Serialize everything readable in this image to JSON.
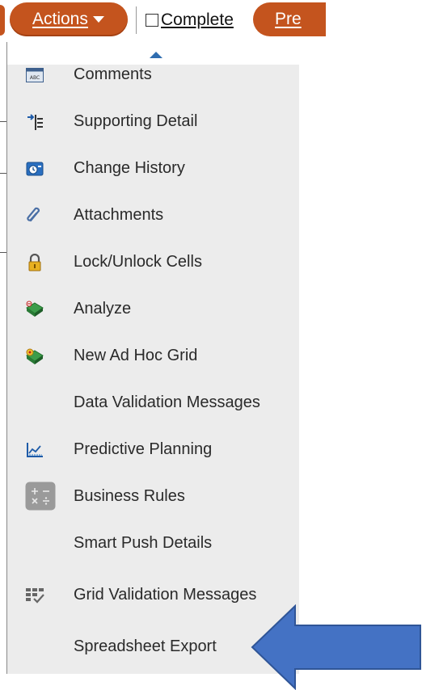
{
  "toolbar": {
    "actions_label": "Actions",
    "complete_label": "Complete",
    "complete_checked": false,
    "prev_label": "Pre"
  },
  "menu": {
    "items": [
      {
        "label": "Comments",
        "icon": "comments-icon"
      },
      {
        "label": "Supporting Detail",
        "icon": "supporting-detail-icon"
      },
      {
        "label": "Change History",
        "icon": "change-history-icon"
      },
      {
        "label": "Attachments",
        "icon": "paperclip-icon"
      },
      {
        "label": "Lock/Unlock Cells",
        "icon": "lock-icon"
      },
      {
        "label": "Analyze",
        "icon": "analyze-icon"
      },
      {
        "label": "New Ad Hoc Grid",
        "icon": "new-ad-hoc-grid-icon"
      },
      {
        "label": "Data Validation Messages",
        "icon": ""
      },
      {
        "label": "Predictive Planning",
        "icon": "predictive-planning-icon"
      },
      {
        "label": "Business Rules",
        "icon": "calculator-icon"
      },
      {
        "label": "Smart Push Details",
        "icon": ""
      },
      {
        "label": "Grid Validation Messages",
        "icon": "grid-validation-icon"
      },
      {
        "label": "Spreadsheet Export",
        "icon": ""
      }
    ]
  },
  "colors": {
    "button": "#c4541e",
    "menu_bg": "#ececec",
    "arrow": "#4472c4"
  },
  "icon_labels": {
    "comments": "ABC"
  }
}
